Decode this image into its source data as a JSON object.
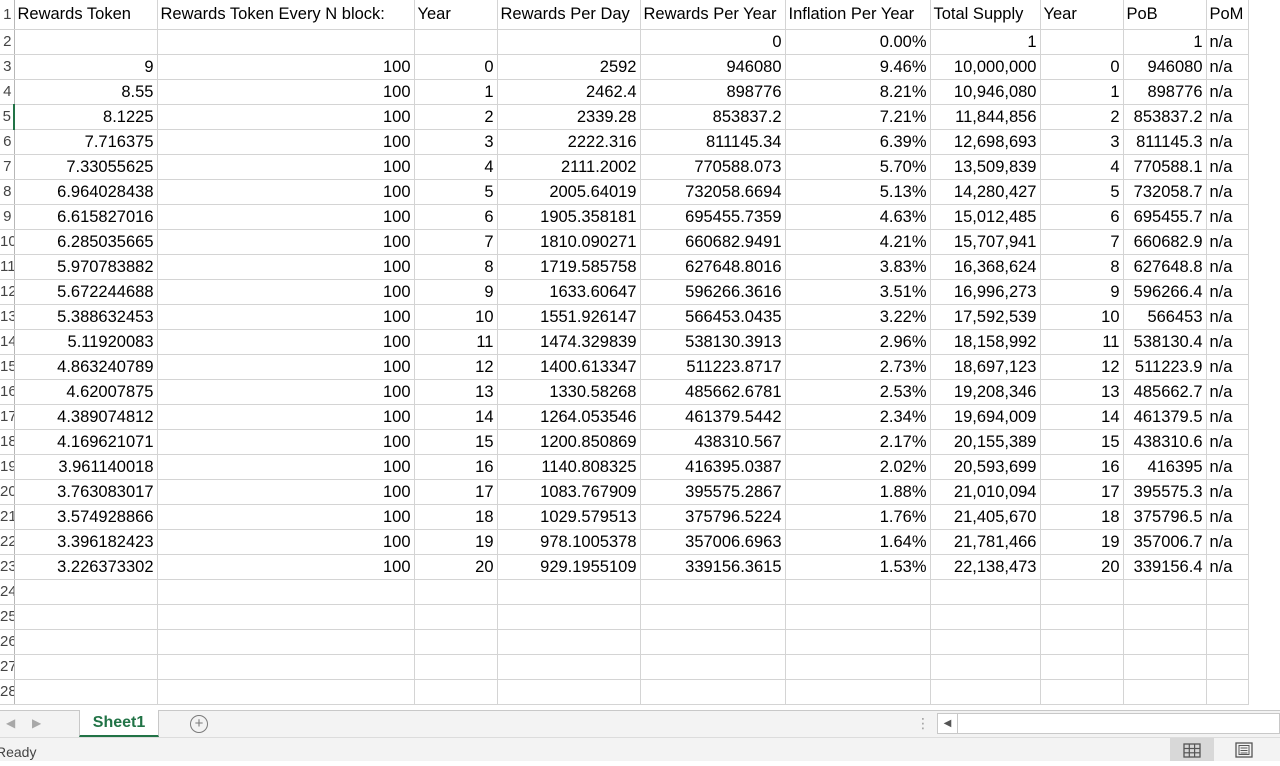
{
  "sheet": {
    "row_numbers": [
      "1",
      "2",
      "3",
      "4",
      "5",
      "6",
      "7",
      "8",
      "9",
      "10",
      "11",
      "12",
      "13",
      "14",
      "15",
      "16",
      "17",
      "18",
      "19",
      "20",
      "21",
      "22",
      "23",
      "24",
      "25",
      "26",
      "27",
      "28"
    ],
    "headers": [
      "Rewards Token",
      "Rewards Token Every N block:",
      "Year",
      "Rewards Per Day",
      "Rewards Per Year",
      "Inflation Per Year",
      "Total Supply",
      "Year",
      "PoB",
      "PoM"
    ],
    "rows": [
      [
        "",
        "",
        "",
        "",
        "0",
        "0.00%",
        "1",
        "",
        "1",
        "n/a"
      ],
      [
        "9",
        "100",
        "0",
        "2592",
        "946080",
        "9.46%",
        "10,000,000",
        "0",
        "946080",
        "n/a"
      ],
      [
        "8.55",
        "100",
        "1",
        "2462.4",
        "898776",
        "8.21%",
        "10,946,080",
        "1",
        "898776",
        "n/a"
      ],
      [
        "8.1225",
        "100",
        "2",
        "2339.28",
        "853837.2",
        "7.21%",
        "11,844,856",
        "2",
        "853837.2",
        "n/a"
      ],
      [
        "7.716375",
        "100",
        "3",
        "2222.316",
        "811145.34",
        "6.39%",
        "12,698,693",
        "3",
        "811145.3",
        "n/a"
      ],
      [
        "7.33055625",
        "100",
        "4",
        "2111.2002",
        "770588.073",
        "5.70%",
        "13,509,839",
        "4",
        "770588.1",
        "n/a"
      ],
      [
        "6.964028438",
        "100",
        "5",
        "2005.64019",
        "732058.6694",
        "5.13%",
        "14,280,427",
        "5",
        "732058.7",
        "n/a"
      ],
      [
        "6.615827016",
        "100",
        "6",
        "1905.358181",
        "695455.7359",
        "4.63%",
        "15,012,485",
        "6",
        "695455.7",
        "n/a"
      ],
      [
        "6.285035665",
        "100",
        "7",
        "1810.090271",
        "660682.9491",
        "4.21%",
        "15,707,941",
        "7",
        "660682.9",
        "n/a"
      ],
      [
        "5.970783882",
        "100",
        "8",
        "1719.585758",
        "627648.8016",
        "3.83%",
        "16,368,624",
        "8",
        "627648.8",
        "n/a"
      ],
      [
        "5.672244688",
        "100",
        "9",
        "1633.60647",
        "596266.3616",
        "3.51%",
        "16,996,273",
        "9",
        "596266.4",
        "n/a"
      ],
      [
        "5.388632453",
        "100",
        "10",
        "1551.926147",
        "566453.0435",
        "3.22%",
        "17,592,539",
        "10",
        "566453",
        "n/a"
      ],
      [
        "5.11920083",
        "100",
        "11",
        "1474.329839",
        "538130.3913",
        "2.96%",
        "18,158,992",
        "11",
        "538130.4",
        "n/a"
      ],
      [
        "4.863240789",
        "100",
        "12",
        "1400.613347",
        "511223.8717",
        "2.73%",
        "18,697,123",
        "12",
        "511223.9",
        "n/a"
      ],
      [
        "4.62007875",
        "100",
        "13",
        "1330.58268",
        "485662.6781",
        "2.53%",
        "19,208,346",
        "13",
        "485662.7",
        "n/a"
      ],
      [
        "4.389074812",
        "100",
        "14",
        "1264.053546",
        "461379.5442",
        "2.34%",
        "19,694,009",
        "14",
        "461379.5",
        "n/a"
      ],
      [
        "4.169621071",
        "100",
        "15",
        "1200.850869",
        "438310.567",
        "2.17%",
        "20,155,389",
        "15",
        "438310.6",
        "n/a"
      ],
      [
        "3.961140018",
        "100",
        "16",
        "1140.808325",
        "416395.0387",
        "2.02%",
        "20,593,699",
        "16",
        "416395",
        "n/a"
      ],
      [
        "3.763083017",
        "100",
        "17",
        "1083.767909",
        "395575.2867",
        "1.88%",
        "21,010,094",
        "17",
        "395575.3",
        "n/a"
      ],
      [
        "3.574928866",
        "100",
        "18",
        "1029.579513",
        "375796.5224",
        "1.76%",
        "21,405,670",
        "18",
        "375796.5",
        "n/a"
      ],
      [
        "3.396182423",
        "100",
        "19",
        "978.1005378",
        "357006.6963",
        "1.64%",
        "21,781,466",
        "19",
        "357006.7",
        "n/a"
      ],
      [
        "3.226373302",
        "100",
        "20",
        "929.1955109",
        "339156.3615",
        "1.53%",
        "22,138,473",
        "20",
        "339156.4",
        "n/a"
      ]
    ],
    "empty_row_count": 5
  },
  "tabs": {
    "active": "Sheet1"
  },
  "status": {
    "text": "Ready"
  },
  "icons": {
    "prev_sheet": "chevron-left-icon",
    "next_sheet": "chevron-right-icon",
    "add_sheet": "plus-circle-icon",
    "normal_view": "grid-icon",
    "page_layout": "page-layout-icon"
  },
  "colors": {
    "accent": "#217346",
    "gridline": "#d4d4d4"
  }
}
